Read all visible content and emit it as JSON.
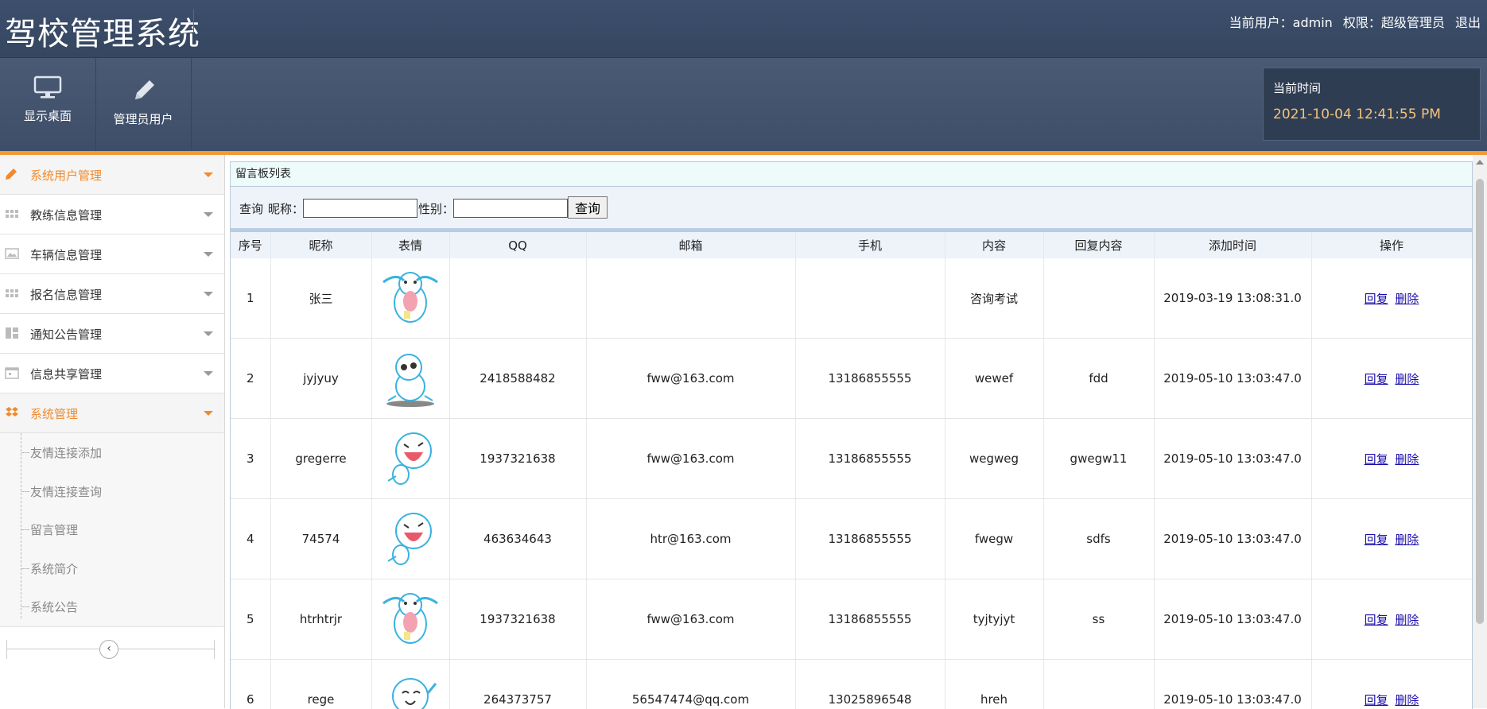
{
  "header": {
    "app_title": "驾校管理系统",
    "current_user_label": "当前用户：admin",
    "role_label": "权限：超级管理员",
    "logout": "退出"
  },
  "toolbar": {
    "desktop": "显示桌面",
    "admin_users": "管理员用户",
    "time_label": "当前时间",
    "time_value": "2021-10-04 12:41:55 PM"
  },
  "sidebar": {
    "items": [
      {
        "label": "系统用户管理",
        "icon": "pencil-icon"
      },
      {
        "label": "教练信息管理",
        "icon": "grid-icon"
      },
      {
        "label": "车辆信息管理",
        "icon": "picture-icon"
      },
      {
        "label": "报名信息管理",
        "icon": "grid-icon"
      },
      {
        "label": "通知公告管理",
        "icon": "layout-icon"
      },
      {
        "label": "信息共享管理",
        "icon": "calendar-icon"
      },
      {
        "label": "系统管理",
        "icon": "dropbox-icon"
      }
    ],
    "sub_items": [
      "友情连接添加",
      "友情连接查询",
      "留言管理",
      "系统简介",
      "系统公告"
    ]
  },
  "main": {
    "panel_title": "留言板列表",
    "search": {
      "query_label": "查询",
      "nickname_label": "昵称：",
      "nickname_value": "",
      "gender_label": "性别：",
      "gender_value": "",
      "button": "查询"
    },
    "table": {
      "headers": [
        "序号",
        "昵称",
        "表情",
        "QQ",
        "邮箱",
        "手机",
        "内容",
        "回复内容",
        "添加时间",
        "操作"
      ],
      "reply_link": "回复",
      "delete_link": "删除",
      "rows": [
        {
          "no": "1",
          "nickname": "张三",
          "face": "crying-face-icon",
          "qq": "",
          "email": "",
          "phone": "",
          "content": "咨询考试",
          "reply": "",
          "time": "2019-03-19 13:08:31.0"
        },
        {
          "no": "2",
          "nickname": "jyjyuy",
          "face": "sitting-face-icon",
          "qq": "2418588482",
          "email": "fww@163.com",
          "phone": "13186855555",
          "content": "wewef",
          "reply": "fdd",
          "time": "2019-05-10 13:03:47.0"
        },
        {
          "no": "3",
          "nickname": "gregerre",
          "face": "laughing-face-icon",
          "qq": "1937321638",
          "email": "fww@163.com",
          "phone": "13186855555",
          "content": "wegweg",
          "reply": "gwegw11",
          "time": "2019-05-10 13:03:47.0"
        },
        {
          "no": "4",
          "nickname": "74574",
          "face": "laughing-face-icon",
          "qq": "463634643",
          "email": "htr@163.com",
          "phone": "13186855555",
          "content": "fwegw",
          "reply": "sdfs",
          "time": "2019-05-10 13:03:47.0"
        },
        {
          "no": "5",
          "nickname": "htrhtrjr",
          "face": "crying-face-icon",
          "qq": "1937321638",
          "email": "fww@163.com",
          "phone": "13186855555",
          "content": "tyjtyjyt",
          "reply": "ss",
          "time": "2019-05-10 13:03:47.0"
        },
        {
          "no": "6",
          "nickname": "rege",
          "face": "waving-face-icon",
          "qq": "264373757",
          "email": "56547474@qq.com",
          "phone": "13025896548",
          "content": "hreh",
          "reply": "",
          "time": "2019-05-10 13:03:47.0"
        }
      ]
    }
  },
  "colors": {
    "accent": "#f39a36",
    "header_bg": "#3d4f6d",
    "active_menu": "#f08a2c",
    "time_text": "#f4c27a"
  }
}
